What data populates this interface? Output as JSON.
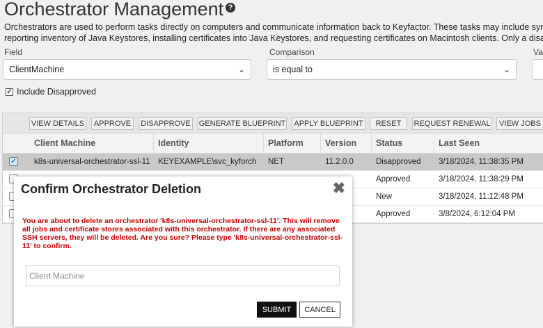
{
  "page": {
    "title": "Orchestrator Management",
    "help_glyph": "?",
    "description_line1": "Orchestrators are used to perform tasks directly on computers and communicate information back to Keyfactor. These tasks may include synch",
    "description_line2": "reporting inventory of Java Keystores, installing certificates into Java Keystores, and requesting certificates on Macintosh clients. Only a disapp"
  },
  "filters": {
    "field_label": "Field",
    "field_value": "ClientMachine",
    "comparison_label": "Comparison",
    "comparison_value": "is equal to",
    "value_label": "Va",
    "include_disapproved_label": "Include Disapproved",
    "include_disapproved_checked": true
  },
  "toolbar": [
    "VIEW DETAILS",
    "APPROVE",
    "DISAPPROVE",
    "GENERATE BLUEPRINT",
    "APPLY BLUEPRINT",
    "RESET",
    "REQUEST RENEWAL",
    "VIEW JOBS"
  ],
  "columns": [
    "Client Machine",
    "Identity",
    "Platform",
    "Version",
    "Status",
    "Last Seen"
  ],
  "rows": [
    {
      "client": "k8s-universal-orchestrator-ssl-11",
      "identity": "KEYEXAMPLE\\svc_kyforch",
      "platform": "NET",
      "version": "11.2.0.0",
      "status": "Disapproved",
      "last_seen": "3/18/2024, 11:38:35 PM",
      "selected": true
    },
    {
      "client": "",
      "identity": "",
      "platform": "",
      "version": "",
      "status": "Approved",
      "last_seen": "3/18/2024, 11:38:29 PM",
      "selected": false
    },
    {
      "client": "",
      "identity": "",
      "platform": "",
      "version": "",
      "status": "New",
      "last_seen": "3/18/2024, 11:12:48 PM",
      "selected": false
    },
    {
      "client": "",
      "identity": "",
      "platform": "",
      "version": "",
      "status": "Approved",
      "last_seen": "3/8/2024, 6:12:04 PM",
      "selected": false
    }
  ],
  "modal": {
    "title": "Confirm Orchestrator Deletion",
    "close_glyph": "✖",
    "warning": "You are about to delete an orchestrator 'k8s-universal-orchestrator-ssl-11'. This will remove all jobs and certificate stores associated with this orchestrator. If there are any associated SSH servers, they will be deleted. Are you sure? Please type 'k8s-universal-orchestrator-ssl-11' to confirm.",
    "input_placeholder": "Client Machine",
    "input_value": "",
    "submit_label": "SUBMIT",
    "cancel_label": "CANCEL"
  },
  "colors": {
    "warning_text": "#cc0000",
    "selected_row": "#c9c9c9",
    "submit_bg": "#111111"
  },
  "icons": {
    "help": "help-circle-icon",
    "dropdown": "chevron-down-icon",
    "checkbox": "checkmark-icon",
    "close": "close-icon"
  }
}
